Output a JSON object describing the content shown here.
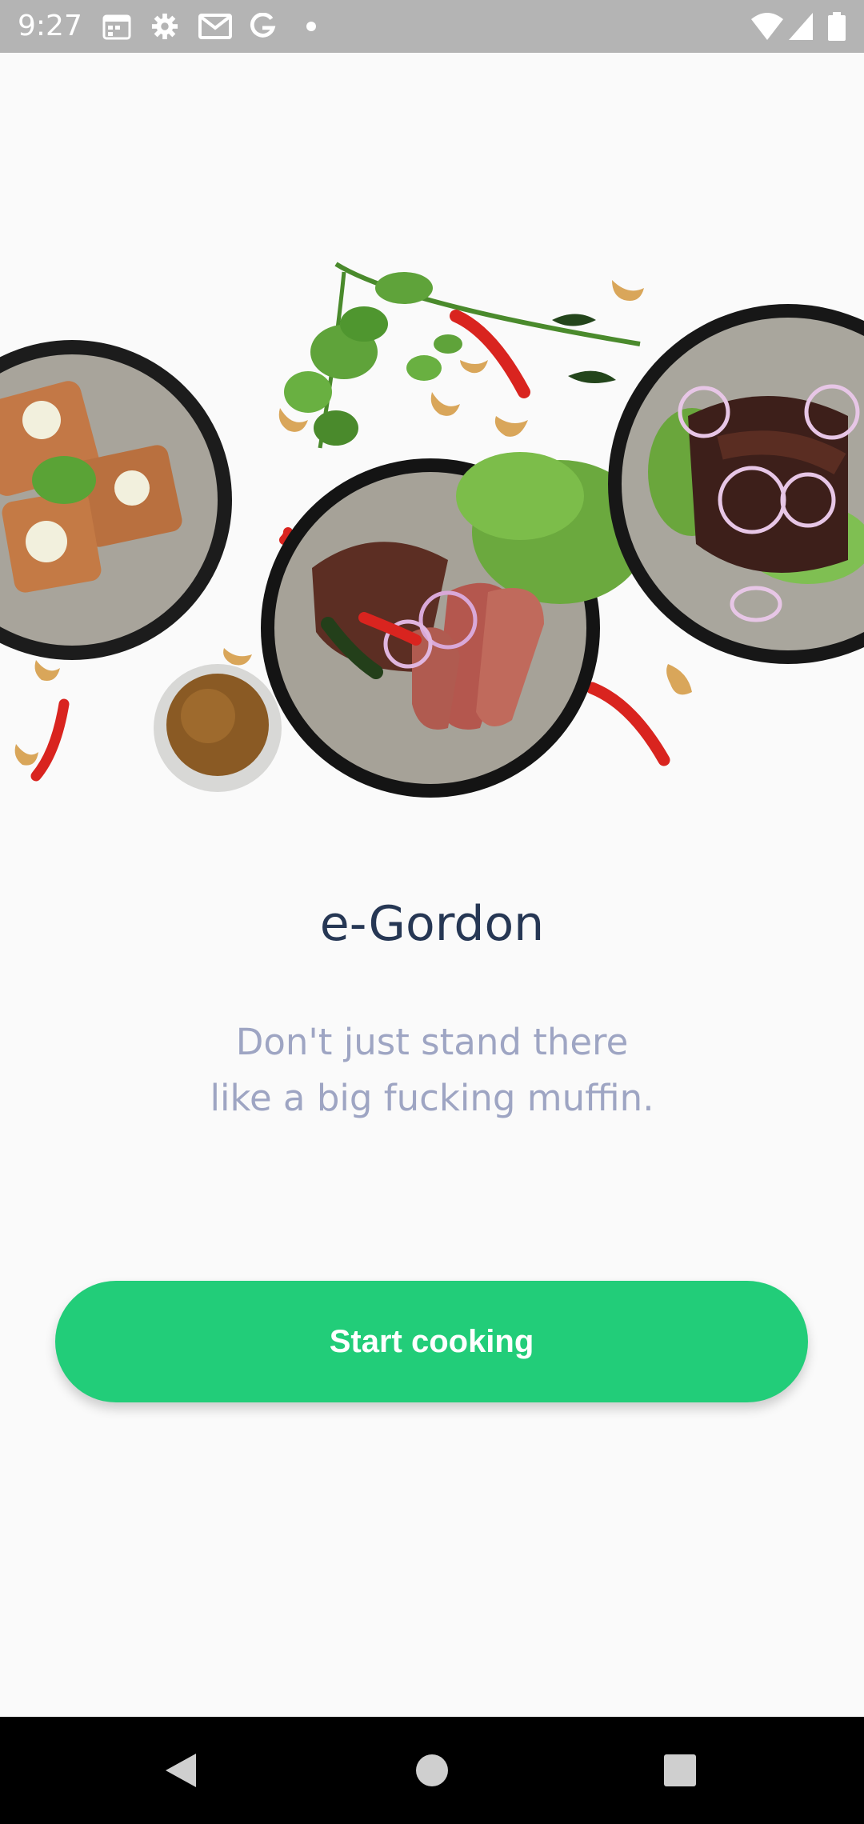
{
  "status_bar": {
    "time": "9:27",
    "left_icons": [
      "calendar-icon",
      "settings-gear-icon",
      "gmail-icon",
      "google-icon",
      "notification-dot-icon"
    ],
    "right_icons": [
      "wifi-icon",
      "cellular-signal-icon",
      "battery-icon"
    ]
  },
  "hero": {
    "description_icons": [
      "food-bowl-icon",
      "steak-plate-icon",
      "salad-plate-icon",
      "sauce-bowl-icon",
      "chili-icon",
      "cashew-icon",
      "herb-icon"
    ]
  },
  "app": {
    "title": "e-Gordon",
    "tagline_line1": "Don't just stand there",
    "tagline_line2": "like a big fucking muffin."
  },
  "cta": {
    "label": "Start cooking"
  },
  "nav_bar": {
    "buttons": [
      "back-icon",
      "home-icon",
      "recents-icon"
    ]
  },
  "colors": {
    "accent": "#22cd79",
    "title": "#263754",
    "tagline": "#9ea5c3",
    "background": "#fafafa"
  }
}
